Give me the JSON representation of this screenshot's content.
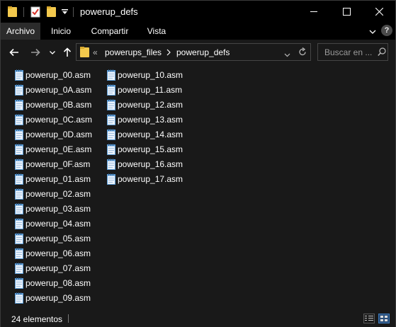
{
  "window": {
    "title": "powerup_defs"
  },
  "ribbon": {
    "tabs": [
      {
        "label": "Archivo",
        "active": true
      },
      {
        "label": "Inicio",
        "active": false
      },
      {
        "label": "Compartir",
        "active": false
      },
      {
        "label": "Vista",
        "active": false
      }
    ],
    "help_label": "?"
  },
  "address": {
    "overflow_label": "«",
    "crumbs": [
      "powerups_files",
      "powerup_defs"
    ]
  },
  "search": {
    "placeholder": "Buscar en ..."
  },
  "files": {
    "column1": [
      "powerup_00.asm",
      "powerup_0A.asm",
      "powerup_0B.asm",
      "powerup_0C.asm",
      "powerup_0D.asm",
      "powerup_0E.asm",
      "powerup_0F.asm",
      "powerup_01.asm",
      "powerup_02.asm",
      "powerup_03.asm",
      "powerup_04.asm",
      "powerup_05.asm",
      "powerup_06.asm",
      "powerup_07.asm",
      "powerup_08.asm",
      "powerup_09.asm"
    ],
    "column2": [
      "powerup_10.asm",
      "powerup_11.asm",
      "powerup_12.asm",
      "powerup_13.asm",
      "powerup_14.asm",
      "powerup_15.asm",
      "powerup_16.asm",
      "powerup_17.asm"
    ]
  },
  "status": {
    "item_count": "24 elementos"
  },
  "colors": {
    "folder": "#f3c94d",
    "accent": "#0078d7",
    "file_icon": "#5b9bd5"
  }
}
